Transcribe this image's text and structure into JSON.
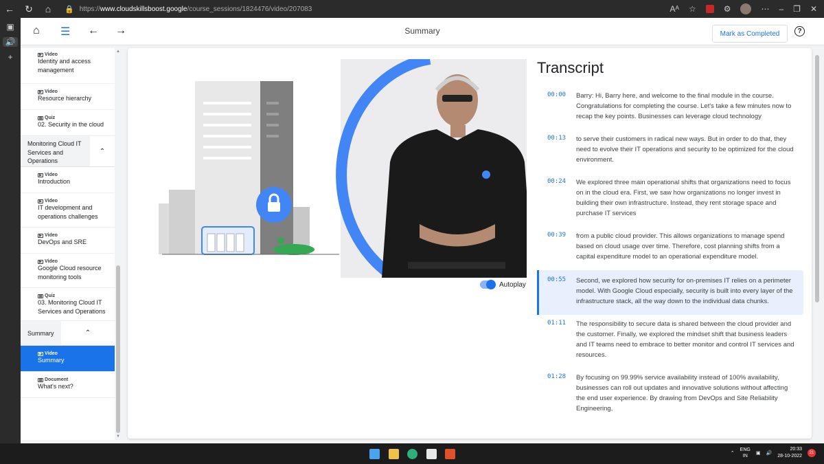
{
  "browser": {
    "url_prefix": "https://",
    "url_domain": "www.cloudskillsboost.google",
    "url_path": "/course_sessions/1824476/video/207083",
    "reader_label": "Aᴬ"
  },
  "header": {
    "title": "Summary",
    "mark_button": "Mark as Completed",
    "help": "?"
  },
  "sidebar": {
    "items": [
      {
        "type": "Video",
        "label": "Identity and access management",
        "kind": "item"
      },
      {
        "type": "Video",
        "label": "Resource hierarchy",
        "kind": "item"
      },
      {
        "type": "Quiz",
        "label": "02. Security in the cloud",
        "kind": "item"
      },
      {
        "label": "Monitoring Cloud IT Services and Operations",
        "kind": "section"
      },
      {
        "type": "Video",
        "label": "Introduction",
        "kind": "item"
      },
      {
        "type": "Video",
        "label": "IT development and operations challenges",
        "kind": "item"
      },
      {
        "type": "Video",
        "label": "DevOps and SRE",
        "kind": "item"
      },
      {
        "type": "Video",
        "label": "Google Cloud resource monitoring tools",
        "kind": "item"
      },
      {
        "type": "Quiz",
        "label": "03. Monitoring Cloud IT Services and Operations",
        "kind": "item"
      },
      {
        "label": "Summary",
        "kind": "section"
      },
      {
        "type": "Video",
        "label": "Summary",
        "kind": "item",
        "active": true
      },
      {
        "type": "Document",
        "label": "What's next?",
        "kind": "item"
      }
    ]
  },
  "player": {
    "autoplay_label": "Autoplay",
    "autoplay_on": true
  },
  "transcript": {
    "title": "Transcript",
    "entries": [
      {
        "time": "00:00",
        "text": "Barry: Hi, Barry here, and welcome to the final module in the course. Congratulations for completing the course. Let's take a few minutes now to recap the key points. Businesses can leverage cloud technology"
      },
      {
        "time": "00:13",
        "text": "to serve their customers in radical new ways. But in order to do that, they need to evolve their IT operations and security to be optimized for the cloud environment."
      },
      {
        "time": "00:24",
        "text": "We explored three main operational shifts that organizations need to focus on in the cloud era. First, we saw how organizations no longer invest in building their own infrastructure. Instead, they rent storage space and purchase IT services"
      },
      {
        "time": "00:39",
        "text": "from a public cloud provider. This allows organizations to manage spend based on cloud usage over time. Therefore, cost planning shifts from a capital expenditure model to an operational expenditure model."
      },
      {
        "time": "00:55",
        "text": "Second, we explored how security for on-premises IT relies on a perimeter model. With Google Cloud especially, security is built into every layer of the infrastructure stack, all the way down to the individual data chunks.",
        "active": true
      },
      {
        "time": "01:11",
        "text": "The responsibility to secure data is shared between the cloud provider and the customer. Finally, we explored the mindset shift that business leaders and IT teams need to embrace to better monitor and control IT services and resources."
      },
      {
        "time": "01:28",
        "text": "By focusing on 99.99% service availability instead of 100% availability, businesses can roll out updates and innovative solutions without affecting the end user experience. By drawing from DevOps and Site Reliability Engineering,"
      }
    ]
  },
  "taskbar": {
    "lang_top": "ENG",
    "lang_bottom": "IN",
    "time": "20:33",
    "date": "28-10-2022",
    "notifications": "21"
  },
  "colors": {
    "accent": "#1a73e8",
    "active_row": "#e8f0fe"
  }
}
